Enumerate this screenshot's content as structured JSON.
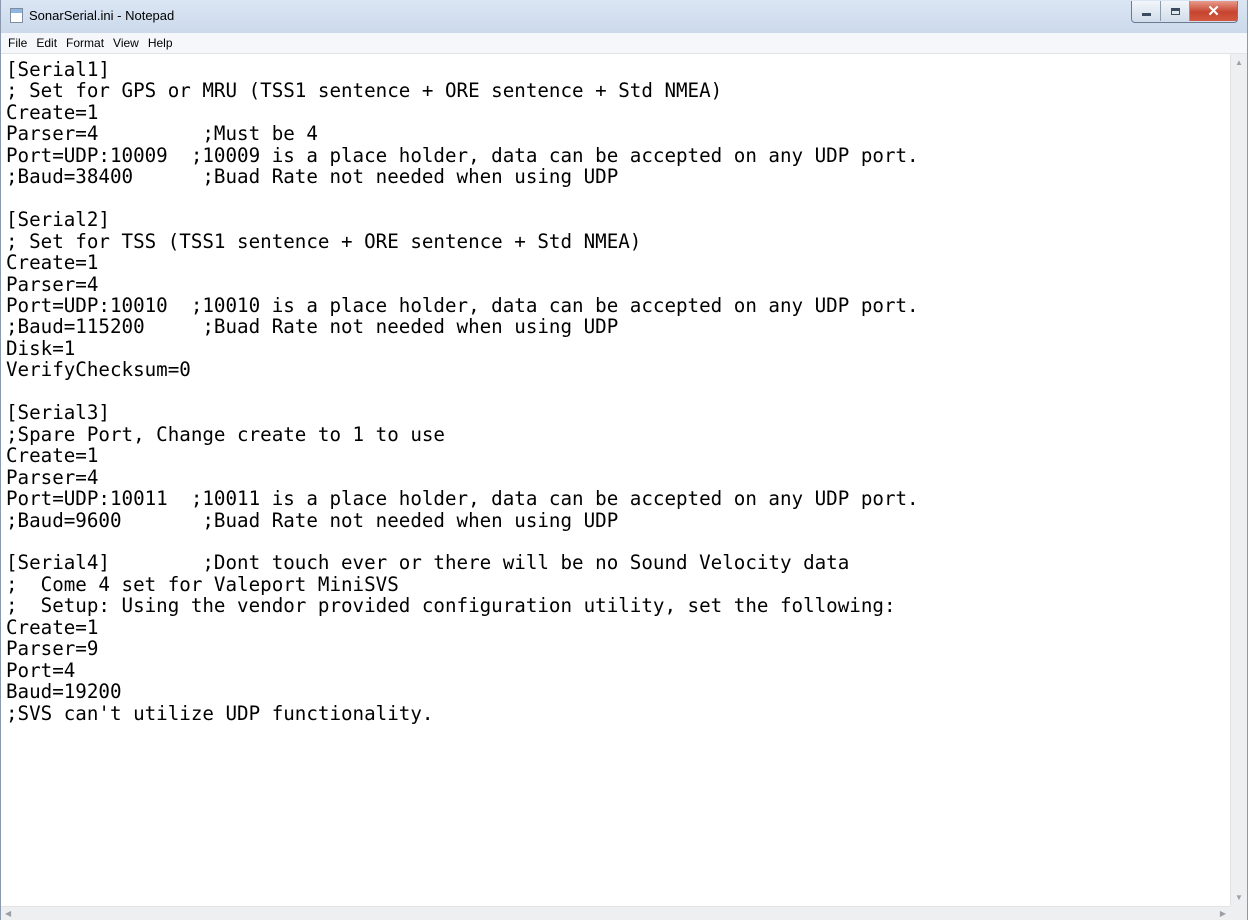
{
  "window": {
    "title": "SonarSerial.ini - Notepad"
  },
  "menu": {
    "items": [
      "File",
      "Edit",
      "Format",
      "View",
      "Help"
    ]
  },
  "editor": {
    "lines": [
      "[Serial1]",
      "; Set for GPS or MRU (TSS1 sentence + ORE sentence + Std NMEA)",
      "Create=1",
      "Parser=4         ;Must be 4",
      "Port=UDP:10009  ;10009 is a place holder, data can be accepted on any UDP port.",
      ";Baud=38400      ;Buad Rate not needed when using UDP",
      "",
      "[Serial2]",
      "; Set for TSS (TSS1 sentence + ORE sentence + Std NMEA)",
      "Create=1",
      "Parser=4",
      "Port=UDP:10010  ;10010 is a place holder, data can be accepted on any UDP port.",
      ";Baud=115200     ;Buad Rate not needed when using UDP",
      "Disk=1",
      "VerifyChecksum=0",
      "",
      "[Serial3]",
      ";Spare Port, Change create to 1 to use",
      "Create=1",
      "Parser=4",
      "Port=UDP:10011  ;10011 is a place holder, data can be accepted on any UDP port.",
      ";Baud=9600       ;Buad Rate not needed when using UDP",
      "",
      "[Serial4]        ;Dont touch ever or there will be no Sound Velocity data",
      ";  Come 4 set for Valeport MiniSVS",
      ";  Setup: Using the vendor provided configuration utility, set the following:",
      "Create=1",
      "Parser=9",
      "Port=4",
      "Baud=19200",
      ";SVS can't utilize UDP functionality."
    ]
  },
  "icons": {
    "app": "notepad-icon",
    "minimize": "minimize-icon",
    "maximize": "maximize-icon",
    "close": "close-icon",
    "scroll_up": "scroll-up-arrow-icon",
    "scroll_down": "scroll-down-arrow-icon",
    "scroll_left": "scroll-left-arrow-icon",
    "scroll_right": "scroll-right-arrow-icon"
  },
  "colors": {
    "close_button": "#c6442f",
    "titlebar": "#cbd9eb"
  }
}
